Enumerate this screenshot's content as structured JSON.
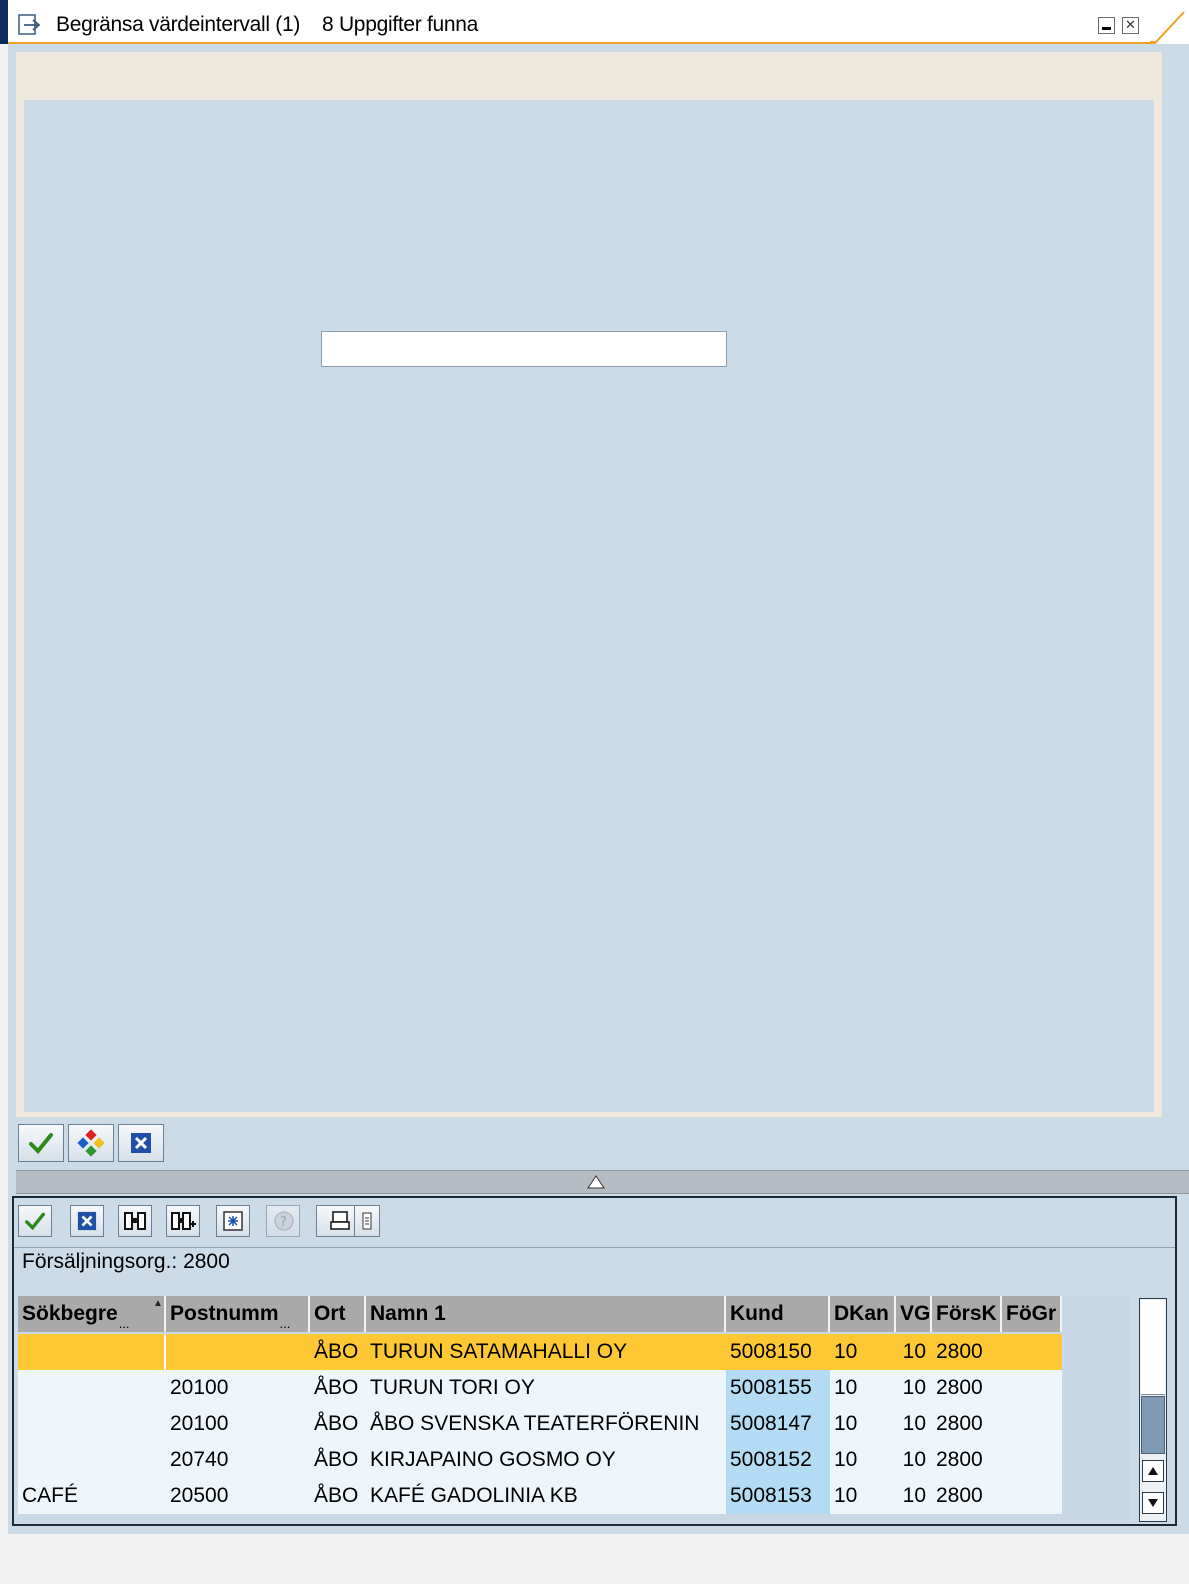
{
  "window": {
    "title": "Begränsa värdeintervall (1)",
    "hits": "8 Uppgifter funna",
    "minimize_icon": "minimize-icon",
    "close_icon": "close-icon"
  },
  "restriction": {
    "search_value": "",
    "buttons": [
      {
        "name": "enter-button",
        "icon": "green-check-icon"
      },
      {
        "name": "multiple-selection-button",
        "icon": "multiple-selection-icon"
      },
      {
        "name": "cancel-button",
        "icon": "cancel-x-icon"
      }
    ]
  },
  "results": {
    "toolbar": [
      {
        "name": "copy-button",
        "icon": "green-check-icon"
      },
      {
        "name": "cancel-button",
        "icon": "cancel-x-icon"
      },
      {
        "name": "find-button",
        "icon": "binoculars-icon"
      },
      {
        "name": "find-next-button",
        "icon": "binoculars-plus-icon"
      },
      {
        "name": "new-search-button",
        "icon": "new-search-icon"
      },
      {
        "name": "info-button",
        "icon": "info-icon",
        "disabled": true
      },
      {
        "name": "print-button",
        "icon": "printer-icon"
      }
    ],
    "org_label": "Försäljningsorg.: 2800",
    "columns": [
      "Sökbegre",
      "Postnumm",
      "Ort",
      "Namn 1",
      "Kund",
      "DKan",
      "VG",
      "FörsK",
      "FöGr"
    ],
    "rows": [
      {
        "sok": "",
        "postnr": "",
        "ort": "ÅBO",
        "namn": "TURUN SATAMAHALLI OY",
        "kund": "5008150",
        "dkan": "10",
        "vg": "10",
        "forsk": "2800",
        "fogr": "",
        "selected": true
      },
      {
        "sok": "",
        "postnr": "20100",
        "ort": "ÅBO",
        "namn": "TURUN TORI OY",
        "kund": "5008155",
        "dkan": "10",
        "vg": "10",
        "forsk": "2800",
        "fogr": ""
      },
      {
        "sok": "",
        "postnr": "20100",
        "ort": "ÅBO",
        "namn": "ÅBO SVENSKA TEATERFÖRENIN",
        "kund": "5008147",
        "dkan": "10",
        "vg": "10",
        "forsk": "2800",
        "fogr": ""
      },
      {
        "sok": "",
        "postnr": "20740",
        "ort": "ÅBO",
        "namn": "KIRJAPAINO GOSMO OY",
        "kund": "5008152",
        "dkan": "10",
        "vg": "10",
        "forsk": "2800",
        "fogr": ""
      },
      {
        "sok": "CAFÉ",
        "postnr": "20500",
        "ort": "ÅBO",
        "namn": "KAFÉ GADOLINIA KB",
        "kund": "5008153",
        "dkan": "10",
        "vg": "10",
        "forsk": "2800",
        "fogr": ""
      }
    ]
  }
}
